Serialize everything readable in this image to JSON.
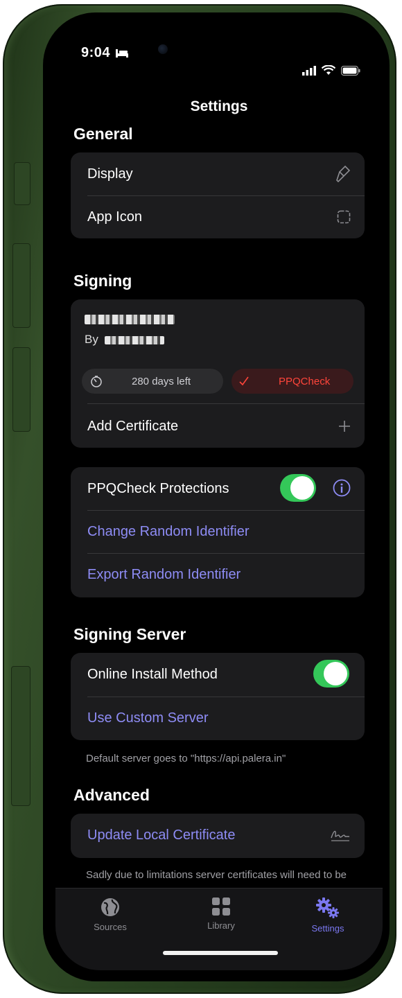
{
  "status": {
    "time": "9:04",
    "bed_icon": "bed-icon",
    "signal_icon": "cellular-signal-icon",
    "wifi_icon": "wifi-icon",
    "battery_icon": "battery-icon"
  },
  "nav": {
    "title": "Settings"
  },
  "general": {
    "header": "General",
    "items": [
      {
        "label": "Display",
        "icon": "paintbrush-icon"
      },
      {
        "label": "App Icon",
        "icon": "app-square-icon"
      }
    ]
  },
  "signing": {
    "header": "Signing",
    "cert_by_prefix": "By",
    "days_left": "280 days left",
    "check_label": "PPQCheck",
    "add_label": "Add Certificate",
    "colors": {
      "pill_ok_bg": "#2c2c2e",
      "pill_check_bg": "#3a1a1c",
      "pill_check_fg": "#ff453a"
    }
  },
  "protections": {
    "toggle_label": "PPQCheck Protections",
    "toggle_on": true,
    "change_label": "Change Random Identifier",
    "export_label": "Export Random Identifier"
  },
  "signing_server": {
    "header": "Signing Server",
    "toggle_label": "Online Install Method",
    "toggle_on": true,
    "custom_label": "Use Custom Server",
    "footnote": "Default server goes to \"https://api.palera.in\""
  },
  "advanced": {
    "header": "Advanced",
    "update_label": "Update Local Certificate",
    "footnote": "Sadly due to limitations server certificates will need to be"
  },
  "tabs": [
    {
      "label": "Sources",
      "icon": "globe-icon",
      "active": false
    },
    {
      "label": "Library",
      "icon": "grid-icon",
      "active": false
    },
    {
      "label": "Settings",
      "icon": "gears-icon",
      "active": true
    }
  ],
  "colors": {
    "accent": "#7b78f0",
    "link": "#8e8cf5",
    "toggle_on": "#34c759",
    "device_frame": "#35502a"
  }
}
